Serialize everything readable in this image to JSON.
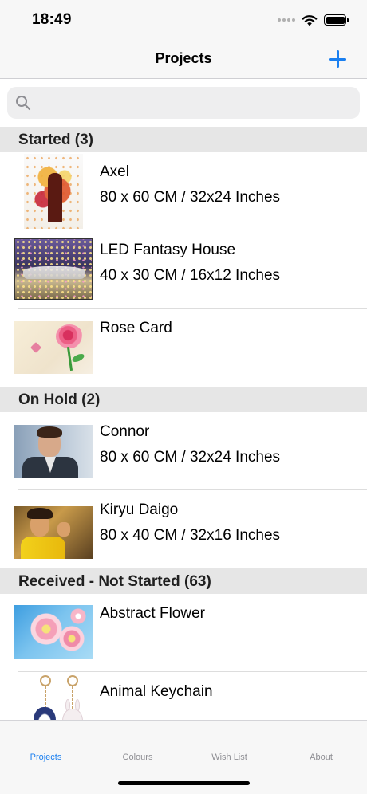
{
  "status_bar": {
    "time": "18:49"
  },
  "nav": {
    "title": "Projects"
  },
  "search": {
    "placeholder": "",
    "value": ""
  },
  "sections": [
    {
      "title": "Started (3)",
      "items": [
        {
          "name": "Axel",
          "size": "80 x 60 CM / 32x24 Inches"
        },
        {
          "name": "LED Fantasy House",
          "size": "40 x 30 CM / 16x12 Inches"
        },
        {
          "name": "Rose Card",
          "size": ""
        }
      ]
    },
    {
      "title": "On Hold (2)",
      "items": [
        {
          "name": "Connor",
          "size": "80 x 60 CM / 32x24 Inches"
        },
        {
          "name": "Kiryu Daigo",
          "size": "80 x 40 CM / 32x16 Inches"
        }
      ]
    },
    {
      "title": "Received - Not Started (63)",
      "items": [
        {
          "name": "Abstract Flower",
          "size": ""
        },
        {
          "name": "Animal Keychain",
          "size": ""
        }
      ]
    }
  ],
  "tabs": [
    {
      "label": "Projects",
      "active": true
    },
    {
      "label": "Colours",
      "active": false
    },
    {
      "label": "Wish List",
      "active": false
    },
    {
      "label": "About",
      "active": false
    }
  ],
  "colors": {
    "accent": "#1a7ff0",
    "section_bg": "#e6e6e6",
    "bar_bg": "#f7f7f7",
    "inactive_tab": "#8e8e93"
  },
  "icons": {
    "add": "plus-icon",
    "search": "magnifying-glass-icon",
    "wifi": "wifi-icon",
    "battery": "battery-icon",
    "signal": "cellular-signal-icon"
  }
}
